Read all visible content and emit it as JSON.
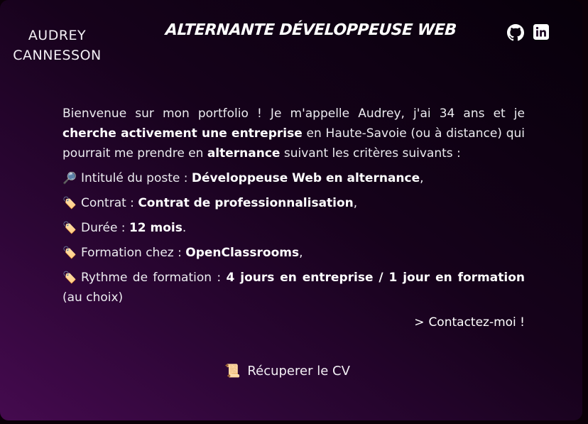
{
  "header": {
    "name_line1": "AUDREY",
    "name_line2": "CANNESSON",
    "headline": "ALTERNANTE DÉVELOPPEUSE WEB",
    "social": [
      {
        "icon": "github-icon"
      },
      {
        "icon": "linkedin-icon"
      }
    ]
  },
  "intro": {
    "t1": "Bienvenue sur mon portfolio ! Je m'appelle Audrey, j'ai 34 ans et je ",
    "b1": "cherche activement une entreprise",
    "t2": " en Haute-Savoie (ou à distance) qui pourrait me prendre en ",
    "b2": "alternance",
    "t3": " suivant les critères suivants :"
  },
  "criteria": [
    {
      "emoji": "🔎",
      "label": "Intitulé du poste : ",
      "value": "Développeuse Web en alternance",
      "suffix": ","
    },
    {
      "emoji": "🏷️",
      "label": "Contrat : ",
      "value": "Contrat de professionnalisation",
      "suffix": ","
    },
    {
      "emoji": "🏷️",
      "label": "Durée : ",
      "value": "12 mois",
      "suffix": "."
    },
    {
      "emoji": "🏷️",
      "label": "Formation chez : ",
      "value": "OpenClassrooms",
      "suffix": ","
    },
    {
      "emoji": "🏷️",
      "label": "Rythme de formation : ",
      "value": "4 jours en entreprise / 1 jour en formation",
      "suffix": " (au choix)"
    }
  ],
  "contact": {
    "chevron": ">",
    "label": "Contactez-moi !"
  },
  "cv": {
    "emoji": "📜",
    "label": "Récuperer le CV"
  },
  "colors": {
    "background_dark": "#07000a",
    "background_accent": "#450a4f",
    "text": "#ffffff"
  }
}
